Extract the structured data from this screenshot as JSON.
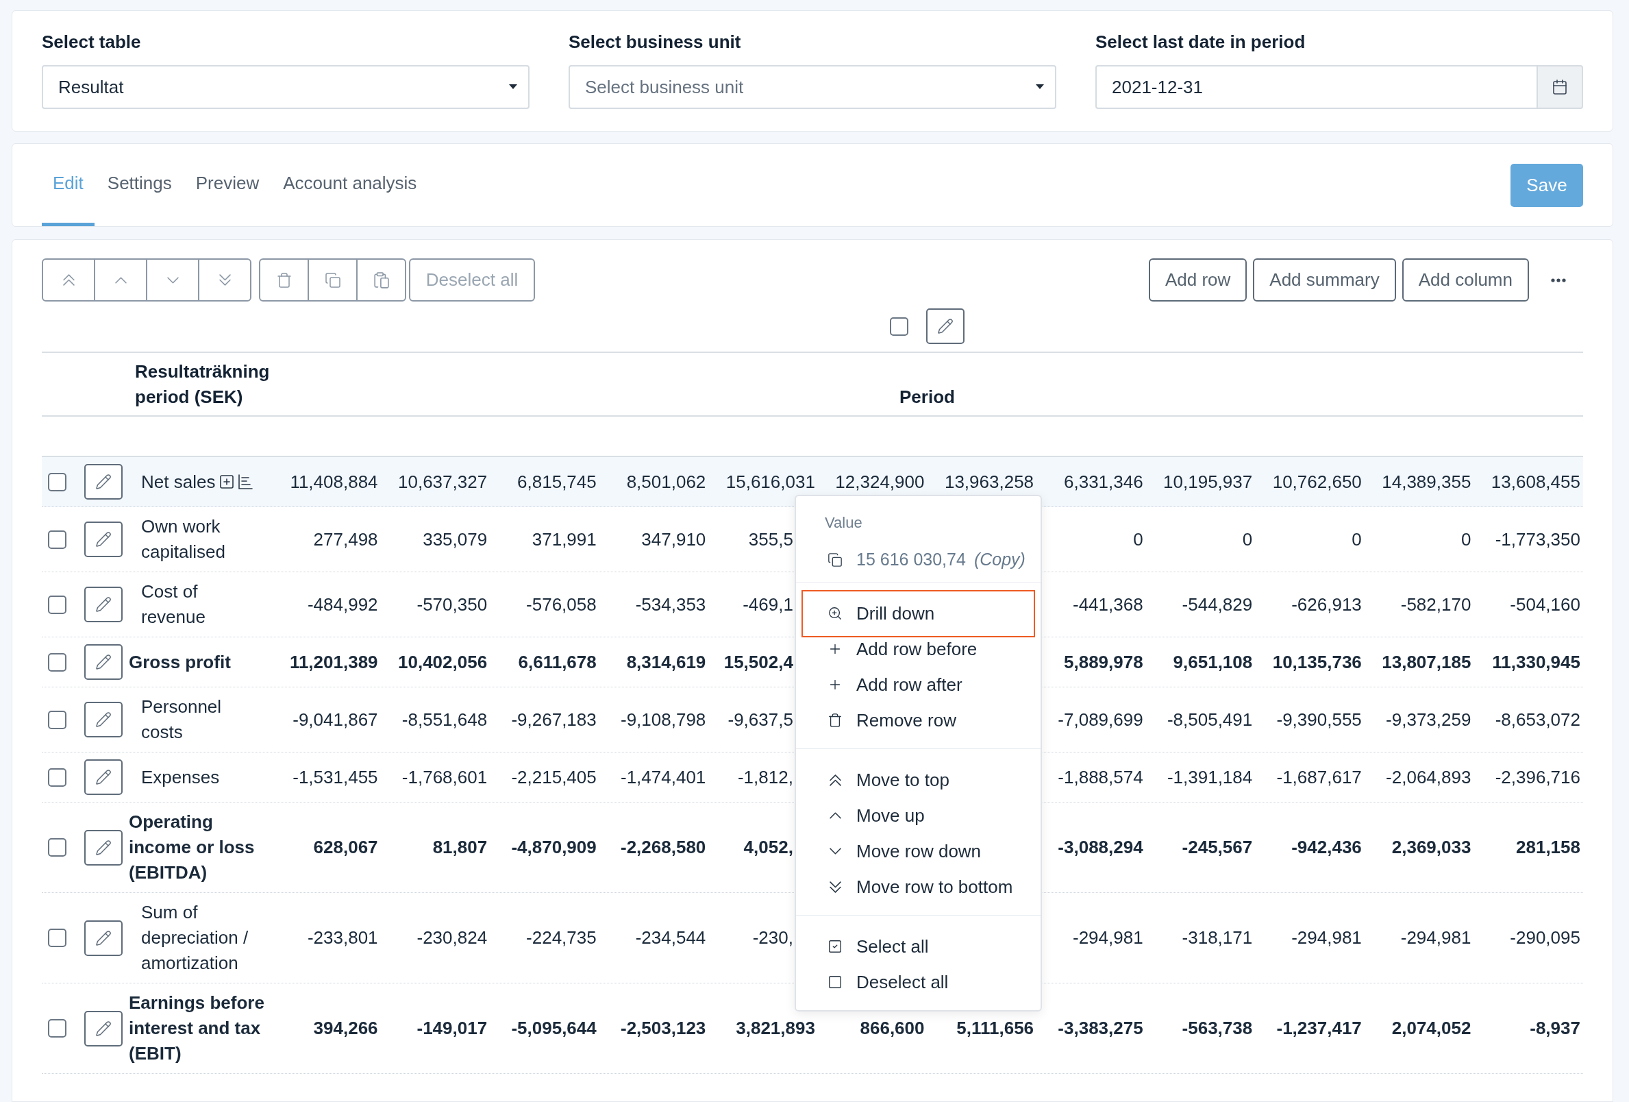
{
  "filters": [
    {
      "kind": "select",
      "label": "Select table",
      "value": "Resultat"
    },
    {
      "kind": "select",
      "label": "Select business unit",
      "placeholder": "Select business unit"
    },
    {
      "kind": "date",
      "label": "Select last date in period",
      "value": "2021-12-31"
    }
  ],
  "tabs": [
    {
      "label": "Edit",
      "selected": true
    },
    {
      "label": "Settings",
      "selected": false
    },
    {
      "label": "Preview",
      "selected": false
    },
    {
      "label": "Account analysis",
      "selected": false
    }
  ],
  "save_button": "Save",
  "toolbar": {
    "row_tools_disabled": true,
    "deselect_button": "Deselect all",
    "actions": [
      "Add row",
      "Add summary",
      "Add column"
    ]
  },
  "column_controls": {
    "checked": false
  },
  "table": {
    "name_heading": "Resultaträkning period (SEK)",
    "group_heading": "Period",
    "rows": [
      {
        "kind": "account",
        "name": "Net sales",
        "checked": false,
        "active": true,
        "details": true,
        "covered": false,
        "values": [
          "11,408,884",
          "10,637,327",
          "6,815,745",
          "8,501,062",
          "15,616,031",
          "12,324,900",
          "13,963,258",
          "6,331,346",
          "10,195,937",
          "10,762,650",
          "14,389,355",
          "13,608,455"
        ]
      },
      {
        "kind": "account",
        "name": "Own work capitalised",
        "checked": false,
        "active": false,
        "details": false,
        "covered": true,
        "values": [
          "277,498",
          "335,079",
          "371,991",
          "347,910",
          "355,5",
          "0",
          "0",
          "0",
          "0",
          "-1,773,350"
        ]
      },
      {
        "kind": "account",
        "name": "Cost of revenue",
        "checked": false,
        "active": false,
        "details": false,
        "covered": true,
        "values": [
          "-484,992",
          "-570,350",
          "-576,058",
          "-534,353",
          "-469,1",
          "-441,368",
          "-544,829",
          "-626,913",
          "-582,170",
          "-504,160"
        ]
      },
      {
        "kind": "summary",
        "name": "Gross profit",
        "checked": false,
        "active": false,
        "details": false,
        "covered": true,
        "values": [
          "11,201,389",
          "10,402,056",
          "6,611,678",
          "8,314,619",
          "15,502,4",
          "5,889,978",
          "9,651,108",
          "10,135,736",
          "13,807,185",
          "11,330,945"
        ]
      },
      {
        "kind": "account",
        "name": "Personnel costs",
        "checked": false,
        "active": false,
        "details": false,
        "covered": true,
        "values": [
          "-9,041,867",
          "-8,551,648",
          "-9,267,183",
          "-9,108,798",
          "-9,637,5",
          "-7,089,699",
          "-8,505,491",
          "-9,390,555",
          "-9,373,259",
          "-8,653,072"
        ]
      },
      {
        "kind": "account",
        "name": "Expenses",
        "checked": false,
        "active": false,
        "details": false,
        "covered": true,
        "values": [
          "-1,531,455",
          "-1,768,601",
          "-2,215,405",
          "-1,474,401",
          "-1,812,",
          "-1,888,574",
          "-1,391,184",
          "-1,687,617",
          "-2,064,893",
          "-2,396,716"
        ]
      },
      {
        "kind": "summary",
        "name": "Operating income or loss (EBITDA)",
        "checked": false,
        "active": false,
        "details": false,
        "covered": true,
        "values": [
          "628,067",
          "81,807",
          "-4,870,909",
          "-2,268,580",
          "4,052,",
          "-3,088,294",
          "-245,567",
          "-942,436",
          "2,369,033",
          "281,158"
        ]
      },
      {
        "kind": "account",
        "name": "Sum of depreciation / amortization",
        "checked": false,
        "active": false,
        "details": false,
        "covered": true,
        "values": [
          "-233,801",
          "-230,824",
          "-224,735",
          "-234,544",
          "-230,",
          "-294,981",
          "-318,171",
          "-294,981",
          "-294,981",
          "-290,095"
        ]
      },
      {
        "kind": "summary",
        "name": "Earnings before interest and tax (EBIT)",
        "checked": false,
        "active": false,
        "details": false,
        "covered": false,
        "values": [
          "394,266",
          "-149,017",
          "-5,095,644",
          "-2,503,123",
          "3,821,893",
          "866,600",
          "5,111,656",
          "-3,383,275",
          "-563,738",
          "-1,237,417",
          "2,074,052",
          "-8,937"
        ]
      }
    ]
  },
  "context_menu": {
    "label": "Value",
    "copy_value": "15 616 030,74",
    "copy_hint": "(Copy)",
    "sections": [
      {
        "items": [
          {
            "kind": "drill_down",
            "label": "Drill down",
            "focused": true
          },
          {
            "kind": "add_before",
            "label": "Add row before",
            "focused": false
          },
          {
            "kind": "add_after",
            "label": "Add row after",
            "focused": false
          },
          {
            "kind": "remove",
            "label": "Remove row",
            "focused": false
          }
        ]
      },
      {
        "items": [
          {
            "kind": "move_top",
            "label": "Move to top",
            "focused": false
          },
          {
            "kind": "move_up",
            "label": "Move up",
            "focused": false
          },
          {
            "kind": "move_down",
            "label": "Move row down",
            "focused": false
          },
          {
            "kind": "move_bottom",
            "label": "Move row to bottom",
            "focused": false
          }
        ]
      },
      {
        "items": [
          {
            "kind": "select_all",
            "label": "Select all",
            "focused": false
          },
          {
            "kind": "deselect_all",
            "label": "Deselect all",
            "focused": false
          }
        ]
      }
    ]
  }
}
